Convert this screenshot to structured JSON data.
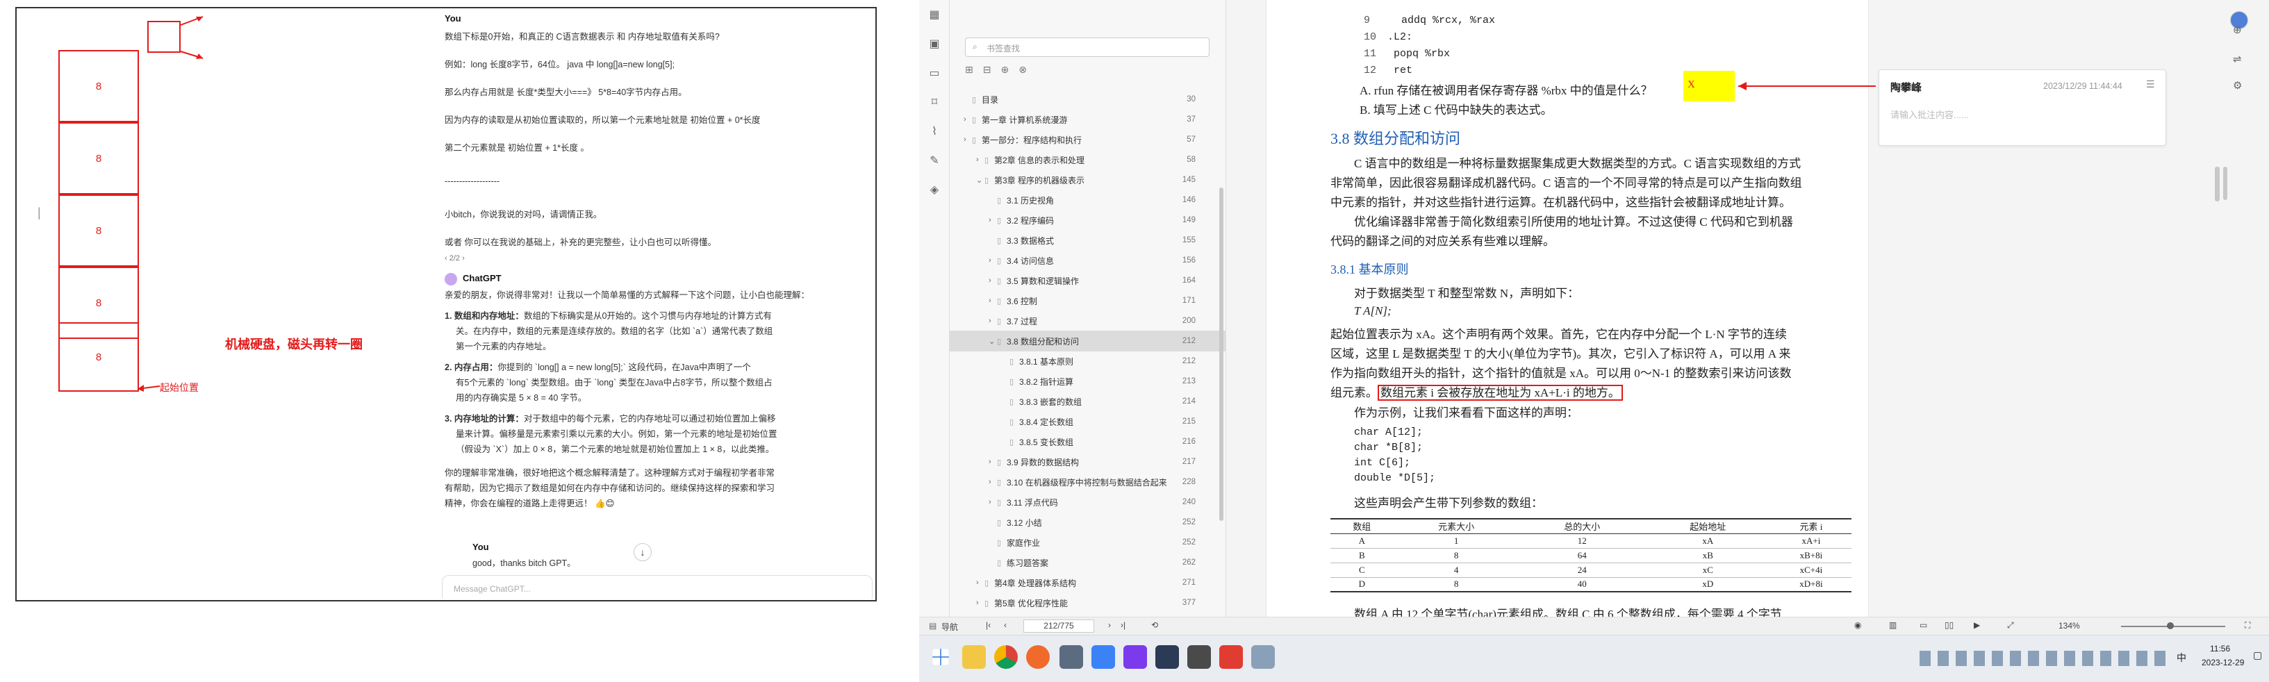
{
  "left_panel": {
    "cells": [
      "8",
      "8",
      "8",
      "8",
      "8"
    ],
    "label_disk": "机械硬盘，磁头再转一圈",
    "label_start": "起始位置",
    "marker_pipe": "|"
  },
  "chat": {
    "user_name": "You",
    "q_lines": [
      "数组下标是0开始，和真正的 C语言数据表示 和 内存地址取值有关系吗?",
      "例如：long 长度8字节，64位。      java 中 long[]a=new long[5];",
      "那么内存占用就是 长度*类型大小===》  5*8=40字节内存占用。",
      "因为内存的读取是从初始位置读取的，所以第一个元素地址就是  初始位置 + 0*长度",
      "第二个元素就是 初始位置 + 1*长度        。",
      "-------------------",
      "小bitch，你说我说的对吗，请调情正我。",
      "  或者 你可以在我说的基础上，补充的更完整些，让小白也可以听得懂。"
    ],
    "pager": "‹ 2/2 ›",
    "gpt_name": "ChatGPT",
    "a_intro": "亲爱的朋友，你说得非常对！让我以一个简单易懂的方式解释一下这个问题，让小白也能理解：",
    "a_items": [
      {
        "n": "1.",
        "head": "数组和内存地址：",
        "lines": [
          "数组的下标确实是从0开始的。这个习惯与内存地址的计算方式有",
          "关。在内存中，数组的元素是连续存放的。数组的名字（比如 `a`）通常代表了数组",
          "第一个元素的内存地址。"
        ]
      },
      {
        "n": "2.",
        "head": "内存占用：",
        "lines": [
          "你提到的 `long[] a = new long[5];` 这段代码，在Java中声明了一个",
          "有5个元素的 `long` 类型数组。由于 `long` 类型在Java中占8字节，所以整个数组占",
          "用的内存确实是 5 × 8 = 40 字节。"
        ]
      },
      {
        "n": "3.",
        "head": "内存地址的计算：",
        "lines": [
          "对于数组中的每个元素，它的内存地址可以通过初始位置加上偏移",
          "量来计算。偏移量是元素索引乘以元素的大小。例如，第一个元素的地址是初始位置",
          "（假设为 `X`）加上 0 × 8，第二个元素的地址就是初始位置加上 1 × 8，以此类推。"
        ]
      }
    ],
    "a_outro": [
      "你的理解非常准确，很好地把这个概念解释清楚了。这种理解方式对于编程初学者非常",
      "有帮助，因为它揭示了数组是如何在内存中存储和访问的。继续保持这样的探索和学习",
      "精神，你会在编程的道路上走得更远！ 👍😊"
    ],
    "last_user_name": "You",
    "last_user_msg": "good，thanks bitch GPT。",
    "input_placeholder": "Message ChatGPT..."
  },
  "reader": {
    "search_placeholder": "书签查找",
    "toc": [
      {
        "label": "目录",
        "page": "30",
        "lvl": 0,
        "arrow": ""
      },
      {
        "label": "第一章 计算机系统漫游",
        "page": "37",
        "lvl": 0,
        "arrow": "›"
      },
      {
        "label": "第一部分：程序结构和执行",
        "page": "57",
        "lvl": 0,
        "arrow": "›"
      },
      {
        "label": "第2章 信息的表示和处理",
        "page": "58",
        "lvl": 1,
        "arrow": "›"
      },
      {
        "label": "第3章 程序的机器级表示",
        "page": "145",
        "lvl": 1,
        "arrow": "⌄"
      },
      {
        "label": "3.1 历史视角",
        "page": "146",
        "lvl": 2,
        "arrow": ""
      },
      {
        "label": "3.2 程序编码",
        "page": "149",
        "lvl": 2,
        "arrow": "›"
      },
      {
        "label": "3.3 数据格式",
        "page": "155",
        "lvl": 2,
        "arrow": ""
      },
      {
        "label": "3.4 访问信息",
        "page": "156",
        "lvl": 2,
        "arrow": "›"
      },
      {
        "label": "3.5 算数和逻辑操作",
        "page": "164",
        "lvl": 2,
        "arrow": "›"
      },
      {
        "label": "3.6 控制",
        "page": "171",
        "lvl": 2,
        "arrow": "›"
      },
      {
        "label": "3.7 过程",
        "page": "200",
        "lvl": 2,
        "arrow": "›"
      },
      {
        "label": "3.8 数组分配和访问",
        "page": "212",
        "lvl": 2,
        "arrow": "⌄"
      },
      {
        "label": "3.8.1 基本原则",
        "page": "212",
        "lvl": 3,
        "arrow": ""
      },
      {
        "label": "3.8.2 指针运算",
        "page": "213",
        "lvl": 3,
        "arrow": ""
      },
      {
        "label": "3.8.3 嵌套的数组",
        "page": "214",
        "lvl": 3,
        "arrow": ""
      },
      {
        "label": "3.8.4 定长数组",
        "page": "215",
        "lvl": 3,
        "arrow": ""
      },
      {
        "label": "3.8.5 变长数组",
        "page": "216",
        "lvl": 3,
        "arrow": ""
      },
      {
        "label": "3.9 异数的数据结构",
        "page": "217",
        "lvl": 2,
        "arrow": "›"
      },
      {
        "label": "3.10 在机器级程序中将控制与数据结合起来",
        "page": "228",
        "lvl": 2,
        "arrow": "›"
      },
      {
        "label": "3.11 浮点代码",
        "page": "240",
        "lvl": 2,
        "arrow": "›"
      },
      {
        "label": "3.12 小结",
        "page": "252",
        "lvl": 2,
        "arrow": ""
      },
      {
        "label": "家庭作业",
        "page": "252",
        "lvl": 2,
        "arrow": ""
      },
      {
        "label": "练习题答案",
        "page": "262",
        "lvl": 2,
        "arrow": ""
      },
      {
        "label": "第4章 处理器体系结构",
        "page": "271",
        "lvl": 1,
        "arrow": "›"
      },
      {
        "label": "第5章 优化程序性能",
        "page": "377",
        "lvl": 1,
        "arrow": "›"
      }
    ],
    "code_top": [
      {
        "n": "9",
        "t": "addq    %rcx, %rax"
      },
      {
        "n": "10",
        "t": ".L2:"
      },
      {
        "n": "11",
        "t": "  popq    %rbx"
      },
      {
        "n": "12",
        "t": "  ret"
      }
    ],
    "qa": "A. rfun 存储在被调用者保存寄存器 %rbx 中的值是什么？",
    "qa_ans": "X",
    "qb": "B. 填写上述 C 代码中缺失的表达式。",
    "sec_title": "3.8  数组分配和访问",
    "para1": [
      "C 语言中的数组是一种将标量数据聚集成更大数据类型的方式。C 语言实现数组的方式",
      "非常简单，因此很容易翻译成机器代码。C 语言的一个不同寻常的特点是可以产生指向数组",
      "中元素的指针，并对这些指针进行运算。在机器代码中，这些指针会被翻译成地址计算。"
    ],
    "para2": [
      "优化编译器非常善于简化数组索引所使用的地址计算。不过这使得 C 代码和它到机器",
      "代码的翻译之间的对应关系有些难以理解。"
    ],
    "sub_title": "3.8.1  基本原则",
    "para3": "对于数据类型 T 和整型常数 N，声明如下：",
    "decl": "T  A[N];",
    "para4": [
      "起始位置表示为 xA。这个声明有两个效果。首先，它在内存中分配一个 L·N 字节的连续",
      "区域，这里 L 是数据类型 T 的大小(单位为字节)。其次，它引入了标识符 A，可以用 A 来",
      "作为指向数组开头的指针，这个指针的值就是 xA。可以用 0～N-1 的整数索引来访问该数"
    ],
    "para4_last_a": "组元素。",
    "para4_boxed": "数组元素 i 会被存放在地址为 xA+L·i 的地方。",
    "para5": "作为示例，让我们来看看下面这样的声明：",
    "code_decl": [
      "char    A[12];",
      "char   *B[8];",
      "int     C[6];",
      "double *D[5];"
    ],
    "para6": "这些声明会产生带下列参数的数组：",
    "table": {
      "headers": [
        "数组",
        "元素大小",
        "总的大小",
        "起始地址",
        "元素 i"
      ],
      "rows": [
        [
          "A",
          "1",
          "12",
          "xA",
          "xA+i"
        ],
        [
          "B",
          "8",
          "64",
          "xB",
          "xB+8i"
        ],
        [
          "C",
          "4",
          "24",
          "xC",
          "xC+4i"
        ],
        [
          "D",
          "8",
          "40",
          "xD",
          "xD+8i"
        ]
      ]
    },
    "bottom_line": "数组 A 由 12 个单字节(char)元素组成。数组 C 由 6 个整数组成，每个需要 4 个字节",
    "comment_author": "陶攀峰",
    "comment_time": "2023/12/29 11:44:44",
    "comment_placeholder": "请输入批注内容......",
    "nav_label": "导航",
    "page_field": "212/775",
    "zoom": "134%"
  },
  "taskbar": {
    "time": "11:56",
    "date": "2023-12-29",
    "ime": "中"
  },
  "colors": {
    "annot_red": "#e31b1b",
    "sec_blue": "#1f5fb4",
    "highlight": "#ffff00"
  }
}
